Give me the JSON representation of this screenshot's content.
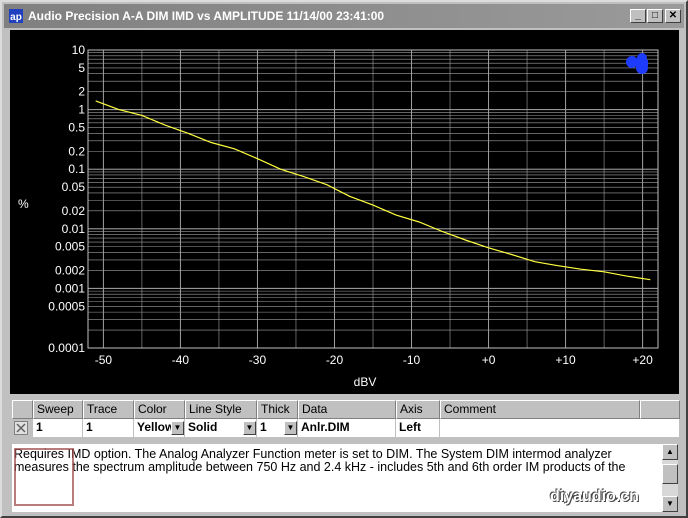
{
  "window": {
    "title": "Audio Precision    A-A DIM IMD vs AMPLITUDE    11/14/00 23:41:00",
    "min_btn": "_",
    "max_btn": "□",
    "close_btn": "✕"
  },
  "colors": {
    "plot_bg": "#000000",
    "grid": "#a0a0a0",
    "trace": "#ffff40",
    "logo": "#1e3cff"
  },
  "chart_data": {
    "type": "line",
    "x_label": "dBV",
    "y_label": "%",
    "xlim": [
      -52,
      22
    ],
    "ylim": [
      0.0001,
      10
    ],
    "y_scale": "log",
    "grid": true,
    "x_ticks": [
      "-50",
      "-40",
      "-30",
      "-20",
      "-10",
      "+0",
      "+10",
      "+20"
    ],
    "y_ticks": [
      "10",
      "5",
      "2",
      "1",
      "0.5",
      "0.2",
      "0.1",
      "0.05",
      "0.02",
      "0.01",
      "0.005",
      "0.002",
      "0.001",
      "0.0005",
      "0.0001"
    ],
    "series": [
      {
        "x": [
          -51,
          -48,
          -45,
          -42,
          -39,
          -36,
          -33,
          -30,
          -27,
          -24,
          -21,
          -18,
          -15,
          -12,
          -9,
          -6,
          -3,
          0,
          3,
          6,
          9,
          12,
          15,
          18,
          21
        ],
        "y": [
          1.4,
          1.0,
          0.8,
          0.55,
          0.4,
          0.28,
          0.22,
          0.15,
          0.1,
          0.075,
          0.055,
          0.035,
          0.025,
          0.017,
          0.013,
          0.009,
          0.0065,
          0.0048,
          0.0037,
          0.0028,
          0.0024,
          0.0021,
          0.0019,
          0.0016,
          0.0014
        ]
      }
    ]
  },
  "table": {
    "headers": [
      "Sweep",
      "Trace",
      "Color",
      "Line Style",
      "Thick",
      "Data",
      "Axis",
      "Comment"
    ],
    "row": {
      "sweep": "1",
      "trace": "1",
      "color": "Yellow",
      "line_style": "Solid",
      "thick": "1",
      "data": "Anlr.DIM",
      "axis": "Left",
      "comment": ""
    }
  },
  "notes": {
    "text": "Requires IMD option.  The Analog Analyzer Function meter is set to DIM.  The System  DIM intermod analyzer measures the spectrum amplitude  between 750 Hz and 2.4 kHz - includes 5th and 6th order IM products of the"
  },
  "watermark": "diyaudio.cn"
}
